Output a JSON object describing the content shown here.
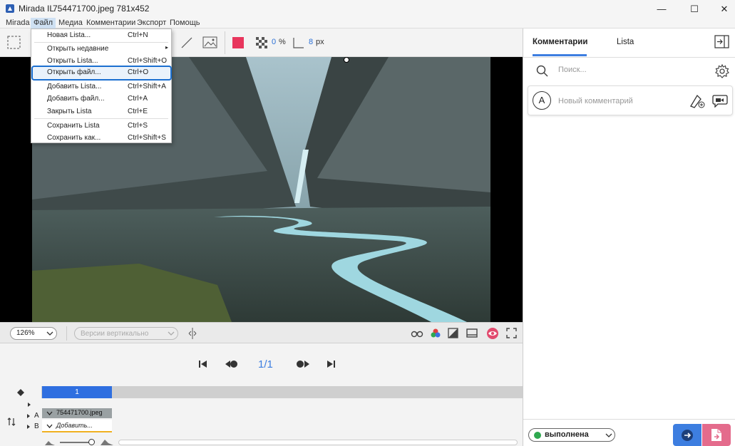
{
  "window": {
    "app_name": "Mirada IL",
    "file_title": "754471700.jpeg 781x452",
    "minimize": "—",
    "maximize": "☐",
    "close": "✕"
  },
  "menubar": {
    "items": [
      "Mirada",
      "Файл",
      "Медиа",
      "Комментарии",
      "Экспорт",
      "Помощь"
    ],
    "active_index": 1
  },
  "file_menu": {
    "items": [
      {
        "label": "Новая Lista...",
        "shortcut": "Ctrl+N"
      },
      {
        "label": "Открыть недавние",
        "shortcut": "",
        "submenu": true
      },
      {
        "label": "Открыть Lista...",
        "shortcut": "Ctrl+Shift+O"
      },
      {
        "label": "Открыть файл...",
        "shortcut": "Ctrl+O",
        "highlighted": true
      },
      {
        "label": "Добавить Lista...",
        "shortcut": "Ctrl+Shift+A"
      },
      {
        "label": "Добавить файл...",
        "shortcut": "Ctrl+A"
      },
      {
        "label": "Закрыть Lista",
        "shortcut": "Ctrl+E"
      },
      {
        "label": "Сохранить Lista",
        "shortcut": "Ctrl+S"
      },
      {
        "label": "Сохранить как...",
        "shortcut": "Ctrl+Shift+S"
      }
    ]
  },
  "toolbar": {
    "color": "#e8365d",
    "opacity_value": "0",
    "opacity_unit": "%",
    "width_value": "8",
    "width_unit": "px"
  },
  "view_controls": {
    "zoom": "126%",
    "versions_placeholder": "Версии вертикально"
  },
  "player": {
    "frame_counter": "1/1"
  },
  "timeline": {
    "frame_number": "1",
    "track_a_label": "A",
    "track_b_label": "B",
    "clip_name": "754471700.jpeg",
    "add_label": "Добавить..."
  },
  "right_panel": {
    "tabs": [
      "Комментарии",
      "Lista"
    ],
    "active_tab": 0,
    "search_placeholder": "Поиск...",
    "avatar_letter": "A",
    "new_comment_placeholder": "Новый комментарий",
    "status": "выполнена",
    "status_color": "#2fa84f"
  },
  "colors": {
    "accent": "#3d7ee0",
    "secondary_action": "#e46b8c"
  }
}
